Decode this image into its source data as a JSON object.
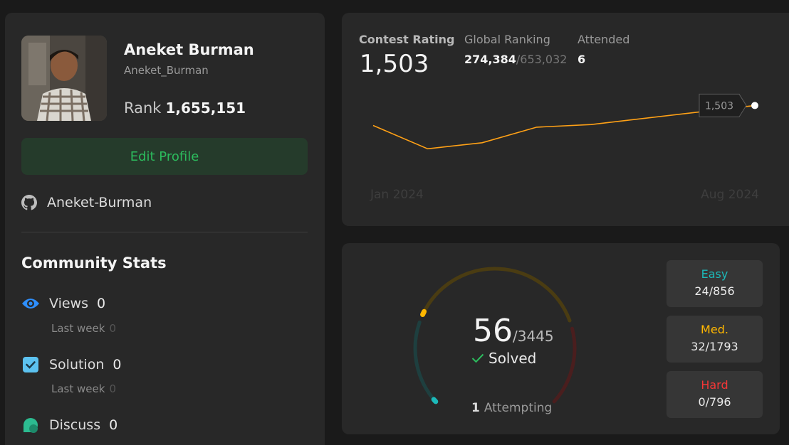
{
  "profile": {
    "name": "Aneket Burman",
    "username": "Aneket_Burman",
    "rank_label": "Rank",
    "rank_value": "1,655,151",
    "edit_label": "Edit Profile",
    "github": "Aneket-Burman"
  },
  "community": {
    "title": "Community Stats",
    "stats": [
      {
        "label": "Views",
        "value": "0",
        "sub_label": "Last week",
        "sub_value": "0",
        "icon": "eye-icon"
      },
      {
        "label": "Solution",
        "value": "0",
        "sub_label": "Last week",
        "sub_value": "0",
        "icon": "check-square-icon"
      },
      {
        "label": "Discuss",
        "value": "0",
        "icon": "chat-bubbles-icon"
      }
    ]
  },
  "contest": {
    "rating_label": "Contest Rating",
    "rating_value": "1,503",
    "ranking_label": "Global Ranking",
    "ranking_value": "274,384",
    "ranking_total": "/653,032",
    "attended_label": "Attended",
    "attended_value": "6"
  },
  "chart_data": {
    "type": "line",
    "x": [
      "2024-01",
      "2024-02",
      "2024-03",
      "2024-04",
      "2024-05",
      "2024-08"
    ],
    "series": [
      {
        "values": [
          1480,
          1453,
          1460,
          1478,
          1481,
          1503
        ]
      }
    ],
    "x_tick_labels": [
      "Jan 2024",
      "Aug 2024"
    ],
    "tooltip": "1,503",
    "color": "#ffa116",
    "grid": false
  },
  "solved": {
    "count": "56",
    "total": "/3445",
    "label": "Solved",
    "attempting_count": "1",
    "attempting_label": "Attempting",
    "difficulties": [
      {
        "name": "Easy",
        "count": "24/856",
        "color": "#1cbaba"
      },
      {
        "name": "Med.",
        "count": "32/1793",
        "color": "#ffb700"
      },
      {
        "name": "Hard",
        "count": "0/796",
        "color": "#f63737"
      }
    ]
  },
  "colors": {
    "accent_green": "#2cbb5d",
    "easy": "#1cbaba",
    "medium": "#ffb700",
    "hard": "#f63737",
    "line": "#ffa116"
  }
}
